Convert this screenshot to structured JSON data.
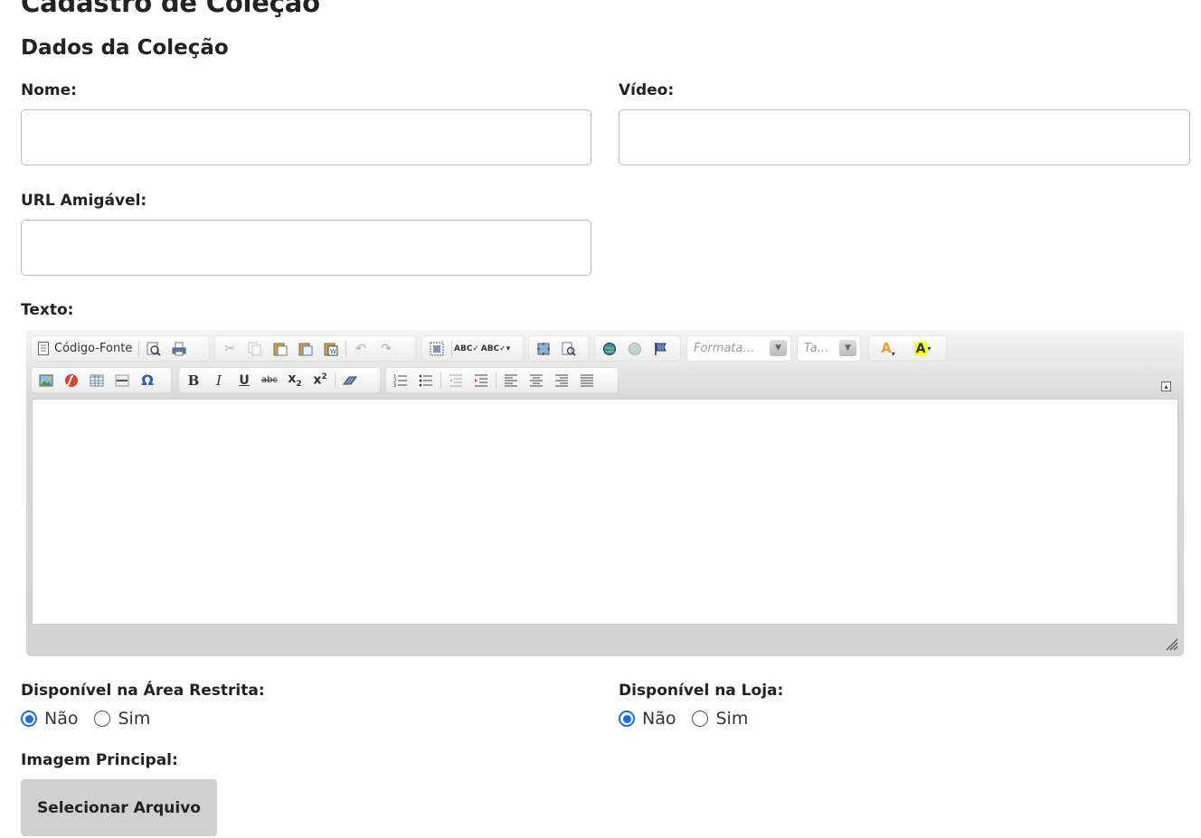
{
  "page": {
    "title": "Cadastro de Coleção",
    "section_title": "Dados da Coleção"
  },
  "form": {
    "nome": {
      "label": "Nome:",
      "value": ""
    },
    "video": {
      "label": "Vídeo:",
      "value": ""
    },
    "url_amigavel": {
      "label": "URL Amigável:",
      "value": ""
    },
    "texto": {
      "label": "Texto:"
    },
    "disponivel_area_restrita": {
      "label": "Disponível na Área Restrita:",
      "options": [
        "Não",
        "Sim"
      ],
      "selected": "Não"
    },
    "disponivel_loja": {
      "label": "Disponível na Loja:",
      "options": [
        "Não",
        "Sim"
      ],
      "selected": "Não"
    },
    "imagem_principal": {
      "label": "Imagem Principal:",
      "button_label": "Selecionar Arquivo"
    }
  },
  "editor": {
    "source_label": "Código-Fonte",
    "format_placeholder": "Formata…",
    "size_placeholder": "Ta…",
    "content": ""
  },
  "colors": {
    "accent": "#1a6fe0",
    "button_bg": "#d0d0d0",
    "border": "#b9b9b9"
  }
}
